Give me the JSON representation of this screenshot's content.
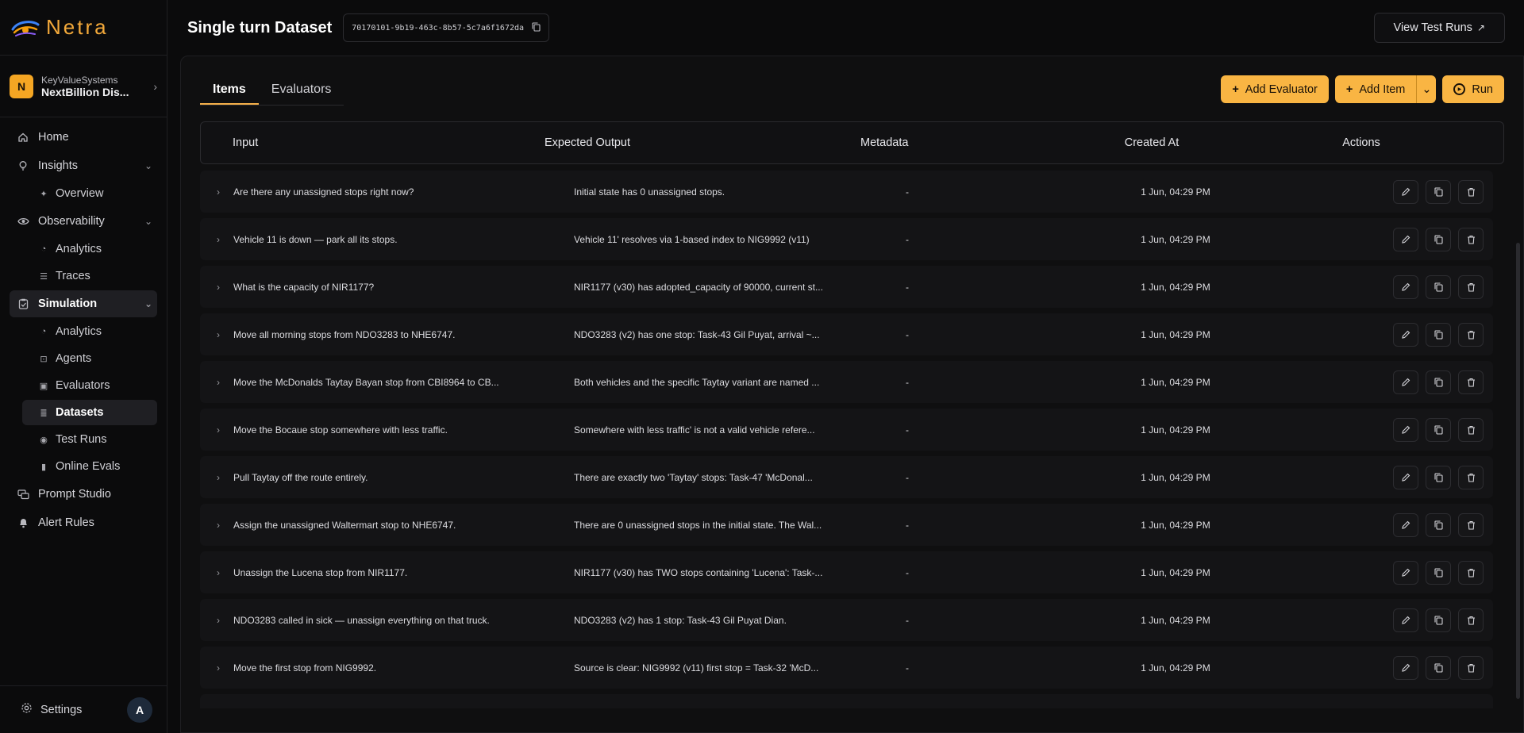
{
  "brand": {
    "name": "Netra"
  },
  "org": {
    "avatar_letter": "N",
    "name": "KeyValueSystems",
    "project": "NextBillion Dis..."
  },
  "nav": {
    "home": "Home",
    "insights": "Insights",
    "overview": "Overview",
    "observability": "Observability",
    "obs_analytics": "Analytics",
    "traces": "Traces",
    "simulation": "Simulation",
    "sim_analytics": "Analytics",
    "agents": "Agents",
    "evaluators": "Evaluators",
    "datasets": "Datasets",
    "test_runs": "Test Runs",
    "online_evals": "Online Evals",
    "prompt_studio": "Prompt Studio",
    "alert_rules": "Alert Rules"
  },
  "footer": {
    "settings": "Settings",
    "user_initial": "A"
  },
  "header": {
    "title": "Single turn Dataset",
    "dataset_id": "70170101-9b19-463c-8b57-5c7a6f1672da",
    "view_test_runs": "View Test Runs"
  },
  "tabs": {
    "items": "Items",
    "evaluators": "Evaluators"
  },
  "buttons": {
    "add_evaluator": "Add Evaluator",
    "add_item": "Add Item",
    "run": "Run"
  },
  "columns": {
    "input": "Input",
    "expected_output": "Expected Output",
    "metadata": "Metadata",
    "created_at": "Created At",
    "actions": "Actions"
  },
  "rows": [
    {
      "input": "Are there any unassigned stops right now?",
      "expected": "Initial state has 0 unassigned stops.",
      "metadata": "-",
      "created": "1 Jun, 04:29 PM"
    },
    {
      "input": "Vehicle 11 is down — park all its stops.",
      "expected": "Vehicle 11' resolves via 1-based index to NIG9992 (v11)",
      "metadata": "-",
      "created": "1 Jun, 04:29 PM"
    },
    {
      "input": "What is the capacity of NIR1177?",
      "expected": "NIR1177 (v30) has adopted_capacity of 90000, current st...",
      "metadata": "-",
      "created": "1 Jun, 04:29 PM"
    },
    {
      "input": "Move all morning stops from NDO3283 to NHE6747.",
      "expected": "NDO3283 (v2) has one stop: Task-43 Gil Puyat, arrival ~...",
      "metadata": "-",
      "created": "1 Jun, 04:29 PM"
    },
    {
      "input": "Move the McDonalds Taytay Bayan stop from CBI8964 to CB...",
      "expected": "Both vehicles and the specific Taytay variant are named ...",
      "metadata": "-",
      "created": "1 Jun, 04:29 PM"
    },
    {
      "input": "Move the Bocaue stop somewhere with less traffic.",
      "expected": "Somewhere with less traffic' is not a valid vehicle refere...",
      "metadata": "-",
      "created": "1 Jun, 04:29 PM"
    },
    {
      "input": "Pull Taytay off the route entirely.",
      "expected": "There are exactly two 'Taytay' stops: Task-47 'McDonal...",
      "metadata": "-",
      "created": "1 Jun, 04:29 PM"
    },
    {
      "input": "Assign the unassigned Waltermart stop to NHE6747.",
      "expected": "There are 0 unassigned stops in the initial state. The Wal...",
      "metadata": "-",
      "created": "1 Jun, 04:29 PM"
    },
    {
      "input": "Unassign the Lucena stop from NIR1177.",
      "expected": "NIR1177 (v30) has TWO stops containing 'Lucena': Task-...",
      "metadata": "-",
      "created": "1 Jun, 04:29 PM"
    },
    {
      "input": "NDO3283 called in sick — unassign everything on that truck.",
      "expected": "NDO3283 (v2) has 1 stop: Task-43 Gil Puyat Dian.",
      "metadata": "-",
      "created": "1 Jun, 04:29 PM"
    },
    {
      "input": "Move the first stop from NIG9992.",
      "expected": "Source is clear: NIG9992 (v11) first stop = Task-32 'McD...",
      "metadata": "-",
      "created": "1 Jun, 04:29 PM"
    }
  ]
}
